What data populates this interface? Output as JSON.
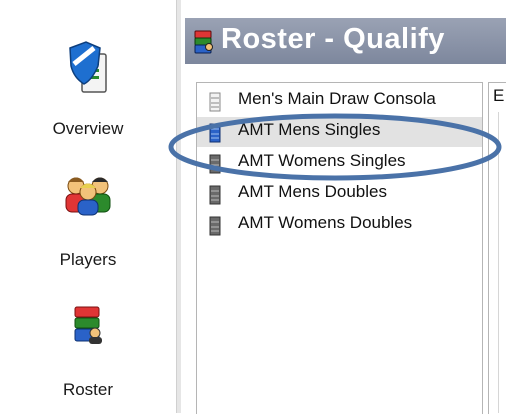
{
  "nav": {
    "items": [
      {
        "label": "Overview",
        "icon": "shield-document-icon"
      },
      {
        "label": "Players",
        "icon": "people-group-icon"
      },
      {
        "label": "Roster",
        "icon": "roster-stack-icon"
      }
    ]
  },
  "header": {
    "title": "Roster - Qualify",
    "icon": "roster-stack-icon"
  },
  "draws": {
    "items": [
      {
        "label": "Men's Main Draw Consola",
        "icon": "draw-list-icon",
        "selected": false
      },
      {
        "label": "AMT Mens Singles",
        "icon": "draw-list-icon",
        "selected": true
      },
      {
        "label": "AMT Womens Singles",
        "icon": "draw-list-icon",
        "selected": false
      },
      {
        "label": "AMT Mens Doubles",
        "icon": "draw-list-icon",
        "selected": false
      },
      {
        "label": "AMT Womens Doubles",
        "icon": "draw-list-icon",
        "selected": false
      }
    ]
  },
  "detail": {
    "fragment": "E"
  },
  "colors": {
    "header_bg": "#8890a5",
    "selected_row": "#e2e2e2",
    "highlight": "#4a72a8"
  }
}
